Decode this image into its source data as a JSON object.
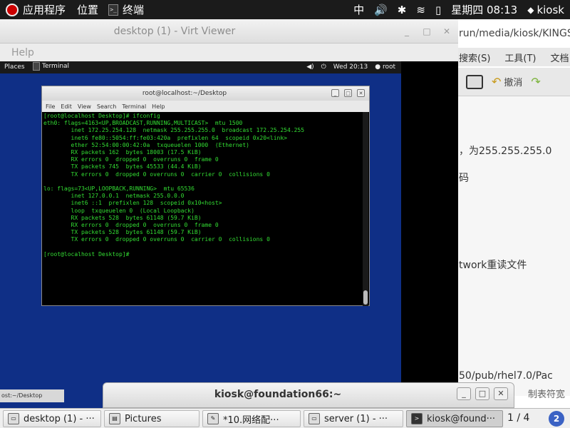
{
  "topbar": {
    "apps_label": "应用程序",
    "places_label": "位置",
    "terminal_label": "终端",
    "input_method": "中",
    "clock": "星期四 08:13",
    "user": "kiosk"
  },
  "doc": {
    "path": "run/media/kiosk/KINGS",
    "menu": [
      "搜索(S)",
      "工具(T)",
      "文档"
    ],
    "undo_label": "撤消",
    "lines": [
      "，为255.255.255.0",
      "码",
      "twork重读文件",
      "50/pub/rhel7.0/Pac"
    ],
    "status_fragment": "制表符宽"
  },
  "virt": {
    "title": "desktop (1) - Virt Viewer",
    "menu_help": "Help"
  },
  "guest": {
    "places": "Places",
    "terminal": "Terminal",
    "clock": "Wed 20:13",
    "user": "root",
    "taskbar_fragment": "ost:~/Desktop",
    "term": {
      "title": "root@localhost:~/Desktop",
      "menu": [
        "File",
        "Edit",
        "View",
        "Search",
        "Terminal",
        "Help"
      ],
      "lines": [
        "[root@localhost Desktop]# ifconfig",
        "eth0: flags=4163<UP,BROADCAST,RUNNING,MULTICAST>  mtu 1500",
        "        inet 172.25.254.128  netmask 255.255.255.0  broadcast 172.25.254.255",
        "        inet6 fe80::5054:ff:fe03:420a  prefixlen 64  scopeid 0x20<link>",
        "        ether 52:54:00:00:42:0a  txqueuelen 1000  (Ethernet)",
        "        RX packets 162  bytes 18003 (17.5 KiB)",
        "        RX errors 0  dropped 0  overruns 0  frame 0",
        "        TX packets 745  bytes 45533 (44.4 KiB)",
        "        TX errors 0  dropped 0 overruns 0  carrier 0  collisions 0",
        "",
        "lo: flags=73<UP,LOOPBACK,RUNNING>  mtu 65536",
        "        inet 127.0.0.1  netmask 255.0.0.0",
        "        inet6 ::1  prefixlen 128  scopeid 0x10<host>",
        "        loop  txqueuelen 0  (Local Loopback)",
        "        RX packets 528  bytes 61148 (59.7 KiB)",
        "        RX errors 0  dropped 0  overruns 0  frame 0",
        "        TX packets 528  bytes 61148 (59.7 KiB)",
        "        TX errors 0  dropped 0 overruns 0  carrier 0  collisions 0",
        "",
        "[root@localhost Desktop]#"
      ]
    }
  },
  "kterm": {
    "title": "kiosk@foundation66:~"
  },
  "taskbar": {
    "items": [
      {
        "label": "desktop (1) - ···",
        "icon": "virt-viewer-icon"
      },
      {
        "label": "Pictures",
        "icon": "folder-icon"
      },
      {
        "label": "*10.网络配···",
        "icon": "text-editor-icon"
      },
      {
        "label": "server (1) - ···",
        "icon": "virt-viewer-icon"
      },
      {
        "label": "kiosk@found···",
        "icon": "terminal-icon"
      }
    ],
    "pager": "1 / 4"
  }
}
